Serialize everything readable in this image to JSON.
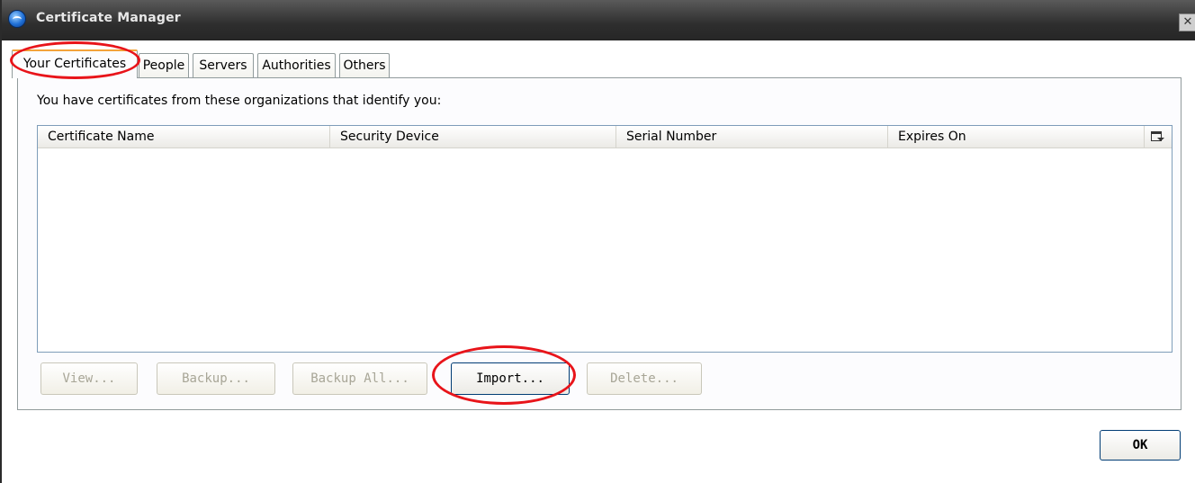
{
  "window": {
    "title": "Certificate Manager",
    "close_glyph": "✕",
    "app_icon": "browser-logo-icon"
  },
  "tabs": [
    {
      "label": "Your Certificates",
      "selected": true
    },
    {
      "label": "People",
      "selected": false
    },
    {
      "label": "Servers",
      "selected": false
    },
    {
      "label": "Authorities",
      "selected": false
    },
    {
      "label": "Others",
      "selected": false
    }
  ],
  "panel": {
    "description": "You have certificates from these organizations that identify you:",
    "columns": [
      "Certificate Name",
      "Security Device",
      "Serial Number",
      "Expires On"
    ],
    "column_picker_icon": "column-picker-icon",
    "rows": []
  },
  "buttons": {
    "view": "View...",
    "backup": "Backup...",
    "backup_all": "Backup All...",
    "import": "Import...",
    "delete": "Delete..."
  },
  "ok_label": "OK",
  "colors": {
    "titlebar": "#2e2e2e",
    "annotation": "#e8141a",
    "selected_tab_accent": "#f3a33a"
  }
}
